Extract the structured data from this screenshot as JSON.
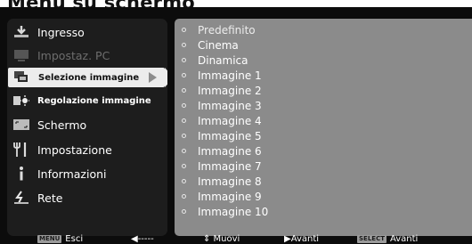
{
  "page": {
    "title": "Menù su schermo"
  },
  "menu": {
    "items": [
      {
        "label": "Ingresso",
        "icon": "input-icon",
        "state": "normal",
        "size": "normal"
      },
      {
        "label": "Impostaz. PC",
        "icon": "pc-settings-icon",
        "state": "disabled",
        "size": "normal"
      },
      {
        "label": "Selezione immagine",
        "icon": "image-select-icon",
        "state": "selected",
        "size": "small"
      },
      {
        "label": "Regolazione immagine",
        "icon": "image-adjust-icon",
        "state": "normal",
        "size": "small"
      },
      {
        "label": "Schermo",
        "icon": "screen-icon",
        "state": "normal",
        "size": "normal"
      },
      {
        "label": "Impostazione",
        "icon": "setting-icon",
        "state": "normal",
        "size": "normal"
      },
      {
        "label": "Informazioni",
        "icon": "info-icon",
        "state": "normal",
        "size": "normal"
      },
      {
        "label": "Rete",
        "icon": "network-icon",
        "state": "normal",
        "size": "normal"
      }
    ]
  },
  "options": {
    "items": [
      "Predefinito",
      "Cinema",
      "Dinamica",
      "Immagine 1",
      "Immagine 2",
      "Immagine 3",
      "Immagine 4",
      "Immagine 5",
      "Immagine 6",
      "Immagine 7",
      "Immagine 8",
      "Immagine 9",
      "Immagine 10"
    ]
  },
  "footer": {
    "exit_key": "MENU",
    "exit_label": "Esci",
    "back_label": "◀-----",
    "move_label": "⇕ Muovi",
    "next_label": "▶Avanti",
    "select_key": "SELECT",
    "select_label": "Avanti"
  },
  "colors": {
    "selected_bg": "#ececec",
    "options_bg": "#8b8b8b",
    "menu_bg": "#1d1d1d"
  }
}
